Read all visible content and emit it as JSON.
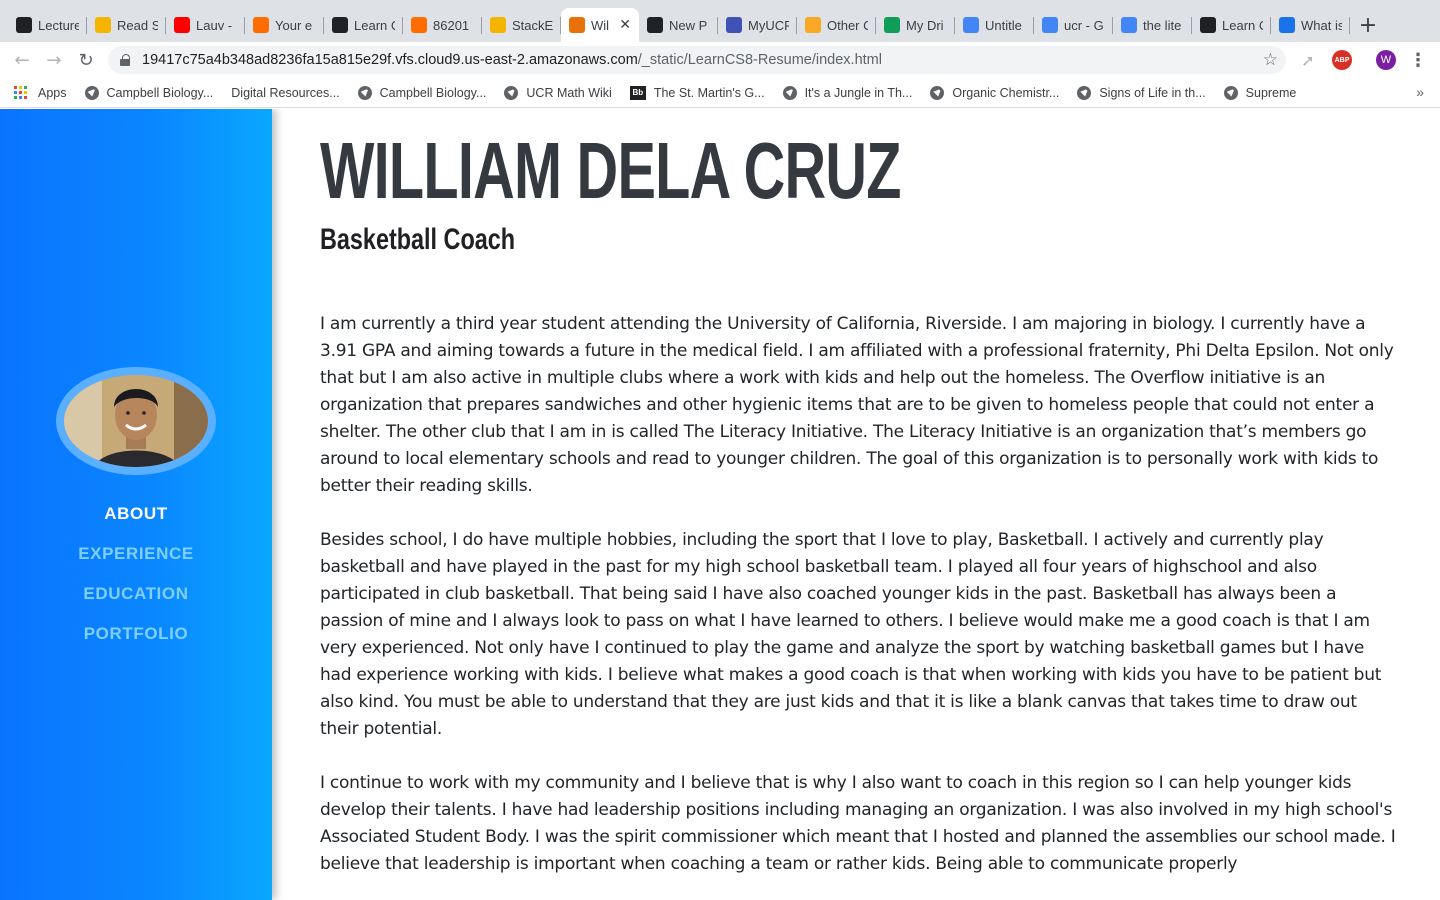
{
  "browser": {
    "tabs": [
      {
        "label": "Lecture",
        "icon": "blackboard-icon",
        "color": "#202124"
      },
      {
        "label": "Read S",
        "icon": "chart-icon",
        "color": "#f4b400"
      },
      {
        "label": "Lauv -",
        "icon": "youtube-icon",
        "color": "#ff0000"
      },
      {
        "label": "Your e",
        "icon": "box-icon",
        "color": "#ff6d00"
      },
      {
        "label": "Learn C",
        "icon": "cat-icon",
        "color": "#202124"
      },
      {
        "label": "86201",
        "icon": "box-icon",
        "color": "#ff6d00"
      },
      {
        "label": "StackE",
        "icon": "stackedit-icon",
        "color": "#f4b400"
      },
      {
        "label": "Wil",
        "icon": "basketball-icon",
        "color": "#e8710a",
        "active": true
      },
      {
        "label": "New P",
        "icon": "github-icon",
        "color": "#202124"
      },
      {
        "label": "MyUCR",
        "icon": "ucr-icon",
        "color": "#3f51b5"
      },
      {
        "label": "Other C",
        "icon": "ucr-logo-icon",
        "color": "#f9a825"
      },
      {
        "label": "My Dri",
        "icon": "drive-icon",
        "color": "#0f9d58"
      },
      {
        "label": "Untitle",
        "icon": "docs-icon",
        "color": "#4285f4"
      },
      {
        "label": "ucr - G",
        "icon": "google-icon",
        "color": "#4285f4"
      },
      {
        "label": "the lite",
        "icon": "google-icon",
        "color": "#4285f4"
      },
      {
        "label": "Learn C",
        "icon": "cat-icon",
        "color": "#202124"
      },
      {
        "label": "What is",
        "icon": "edge-icon",
        "color": "#1a73e8"
      }
    ],
    "url_host": "19417c75a4b348ad8236fa15a815e29f.vfs.cloud9.us-east-2.amazonaws.com",
    "url_path": "/_static/LearnCS8-Resume/index.html",
    "extension_w": "W",
    "extension_abp": "ABP",
    "bookmarks": [
      {
        "label": "Apps",
        "type": "apps"
      },
      {
        "label": "Campbell Biology...",
        "type": "globe"
      },
      {
        "label": "Digital Resources...",
        "type": "none"
      },
      {
        "label": "Campbell Biology...",
        "type": "globe"
      },
      {
        "label": "UCR Math Wiki",
        "type": "globe"
      },
      {
        "label": "The St. Martin's G...",
        "type": "bb"
      },
      {
        "label": "It's a Jungle in Th...",
        "type": "globe"
      },
      {
        "label": "Organic Chemistr...",
        "type": "globe"
      },
      {
        "label": "Signs of Life in th...",
        "type": "globe"
      },
      {
        "label": "Supreme",
        "type": "globe"
      }
    ]
  },
  "sidebar": {
    "nav": [
      {
        "label": "ABOUT",
        "active": true
      },
      {
        "label": "EXPERIENCE",
        "active": false
      },
      {
        "label": "EDUCATION",
        "active": false
      },
      {
        "label": "PORTFOLIO",
        "active": false
      }
    ]
  },
  "main": {
    "name": "WILLIAM DELA CRUZ",
    "role": "Basketball Coach",
    "paragraphs": [
      "I am currently a third year student attending the University of California, Riverside. I am majoring in biology. I currently have a 3.91 GPA and aiming towards a future in the medical field. I am affiliated with a professional fraternity, Phi Delta Epsilon. Not only that but I am also active in multiple clubs where a work with kids and help out the homeless. The Overflow initiative is an organization that prepares sandwiches and other hygienic items that are to be given to homeless people that could not enter a shelter. The other club that I am in is called The Literacy Initiative. The Literacy Initiative is an organization that’s members go around to local elementary schools and read to younger children. The goal of this organization is to personally work with kids to better their reading skills.",
      "Besides school, I do have multiple hobbies, including the sport that I love to play, Basketball. I actively and currently play basketball and have played in the past for my high school basketball team. I played all four years of highschool and also participated in club basketball. That being said I have also coached younger kids in the past. Basketball has always been a passion of mine and I always look to pass on what I have learned to others. I believe would make me a good coach is that I am very experienced. Not only have I continued to play the game and analyze the sport by watching basketball games but I have had experience working with kids. I believe what makes a good coach is that when working with kids you have to be patient but also kind. You must be able to understand that they are just kids and that it is like a blank canvas that takes time to draw out their potential.",
      "I continue to work with my community and I believe that is why I also want to coach in this region so I can help younger kids develop their talents. I have had leadership positions including managing an organization. I was also involved in my high school's Associated Student Body. I was the spirit commissioner which meant that I hosted and planned the assemblies our school made. I believe that leadership is important when coaching a team or rather kids. Being able to communicate properly"
    ]
  },
  "colors": {
    "sidebar_left": "#0a74ff",
    "sidebar_right": "#0aa7ff",
    "nav_active": "#ffffff",
    "nav_inactive": "#7fcfff",
    "heading": "#343a40"
  }
}
